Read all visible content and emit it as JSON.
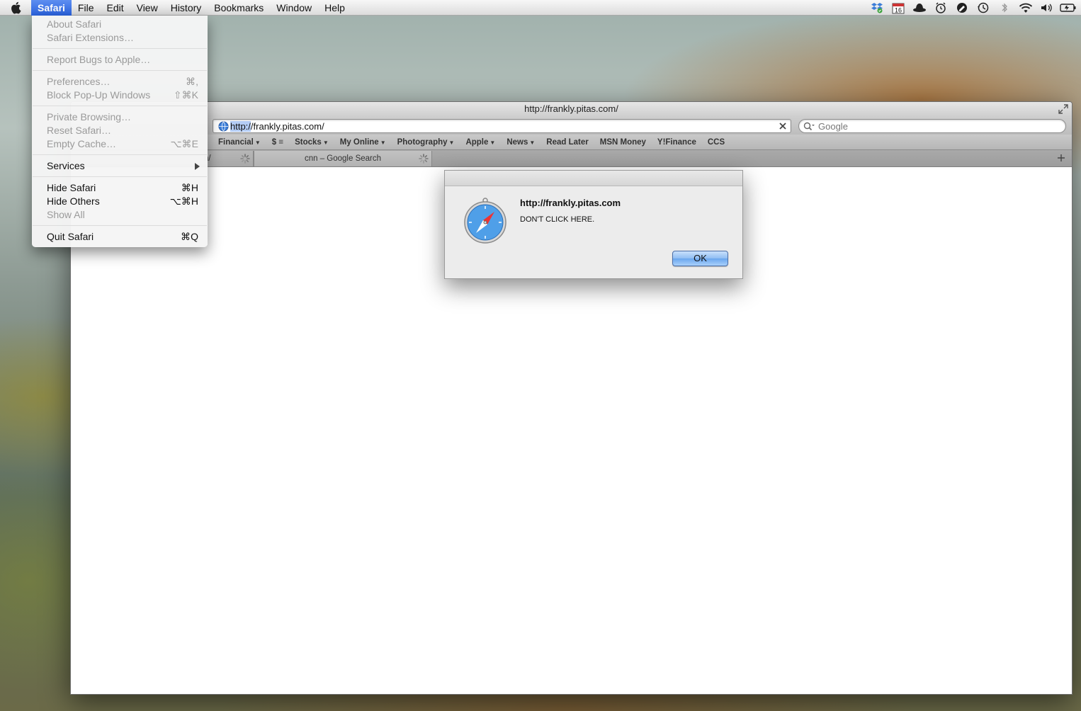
{
  "menubar": {
    "app_name": "Safari",
    "items": [
      "File",
      "Edit",
      "View",
      "History",
      "Bookmarks",
      "Window",
      "Help"
    ],
    "calendar_day": "16",
    "status_icons": [
      "dropbox-icon",
      "calendar-icon",
      "hat-icon",
      "alarm-icon",
      "pen-icon",
      "time-machine-icon",
      "bluetooth-icon",
      "wifi-icon",
      "volume-icon",
      "battery-icon"
    ]
  },
  "safari_menu": {
    "items": [
      {
        "label": "About Safari",
        "shortcut": "",
        "enabled": false
      },
      {
        "label": "Safari Extensions…",
        "shortcut": "",
        "enabled": false
      },
      {
        "label": "Report Bugs to Apple…",
        "shortcut": "",
        "enabled": false
      },
      {
        "label": "Preferences…",
        "shortcut": "⌘,",
        "enabled": false
      },
      {
        "label": "Block Pop-Up Windows",
        "shortcut": "⇧⌘K",
        "enabled": false
      },
      {
        "label": "Private Browsing…",
        "shortcut": "",
        "enabled": false
      },
      {
        "label": "Reset Safari…",
        "shortcut": "",
        "enabled": false
      },
      {
        "label": "Empty Cache…",
        "shortcut": "⌥⌘E",
        "enabled": false
      },
      {
        "label": "Services",
        "shortcut": "",
        "enabled": true,
        "submenu": true
      },
      {
        "label": "Hide Safari",
        "shortcut": "⌘H",
        "enabled": true
      },
      {
        "label": "Hide Others",
        "shortcut": "⌥⌘H",
        "enabled": true
      },
      {
        "label": "Show All",
        "shortcut": "",
        "enabled": false
      },
      {
        "label": "Quit Safari",
        "shortcut": "⌘Q",
        "enabled": true
      }
    ]
  },
  "window": {
    "title": "http://frankly.pitas.com/",
    "url_selected": "http:/",
    "url_rest": "/frankly.pitas.com/",
    "search_placeholder": "Google",
    "bookmarks": [
      {
        "label": "Financial",
        "menu": true
      },
      {
        "label": "$ ≡",
        "menu": false
      },
      {
        "label": "Stocks",
        "menu": true
      },
      {
        "label": "My Online",
        "menu": true
      },
      {
        "label": "Photography",
        "menu": true
      },
      {
        "label": "Apple",
        "menu": true
      },
      {
        "label": "News",
        "menu": true
      },
      {
        "label": "Read Later",
        "menu": false
      },
      {
        "label": "MSN Money",
        "menu": false
      },
      {
        "label": "Y!Finance",
        "menu": false
      },
      {
        "label": "CCS",
        "menu": false
      }
    ],
    "tabs": [
      {
        "title": "n/"
      },
      {
        "title": "cnn – Google Search"
      }
    ]
  },
  "alert": {
    "title": "http://frankly.pitas.com",
    "message": "DON'T CLICK HERE.",
    "ok_label": "OK"
  },
  "colors": {
    "menu_highlight": "#2a63e0",
    "disabled_text": "#9a9a9a"
  }
}
